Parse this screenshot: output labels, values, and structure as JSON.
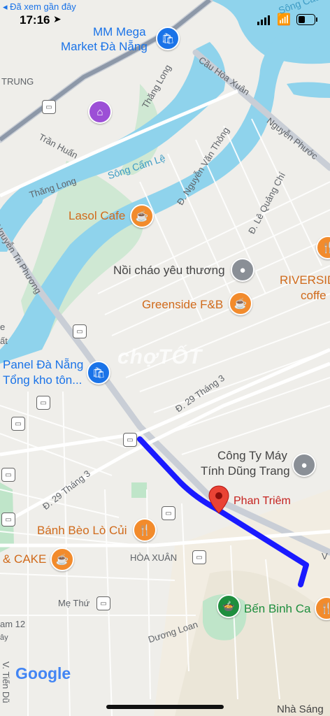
{
  "status_bar": {
    "back_link": "◂ Đã xem gần đây",
    "time": "17:16"
  },
  "pois": [
    {
      "id": "mm-mega-1",
      "text": "MM Mega"
    },
    {
      "id": "mm-mega-2",
      "text": "Market Đà Nẵng"
    },
    {
      "id": "lasol",
      "text": "Lasol Cafe"
    },
    {
      "id": "noi-chao",
      "text": "Nồi cháo yêu thương"
    },
    {
      "id": "greenside",
      "text": "Greenside F&B"
    },
    {
      "id": "riverside-1",
      "text": "RIVERSID"
    },
    {
      "id": "riverside-2",
      "text": "coffe"
    },
    {
      "id": "panel-1",
      "text": "Panel Đà Nẵng"
    },
    {
      "id": "panel-2",
      "text": "Tổng kho tôn..."
    },
    {
      "id": "cong-ty-1",
      "text": "Công Ty Máy"
    },
    {
      "id": "cong-ty-2",
      "text": "Tính Dũng Trang"
    },
    {
      "id": "phan-triem",
      "text": "Phan Triêm"
    },
    {
      "id": "banh-beo",
      "text": "Bánh Bèo Lò Củi"
    },
    {
      "id": "cake",
      "text": "& CAKE"
    },
    {
      "id": "ben-binh-ca",
      "text": "Bến Binh Ca"
    },
    {
      "id": "nha-sang",
      "text": "Nhà Sáng"
    }
  ],
  "streets": [
    {
      "id": "trung",
      "text": "TRUNG"
    },
    {
      "id": "thang-long-1",
      "text": "Thăng Long"
    },
    {
      "id": "tran-huan",
      "text": "Trần Huấn"
    },
    {
      "id": "thang-long-2",
      "text": "Thăng Long"
    },
    {
      "id": "song-cam-le",
      "text": "Sông Cẩm Lệ"
    },
    {
      "id": "cau-hoa-xuan",
      "text": "Cầu Hòa Xuân"
    },
    {
      "id": "nguyen-phuoc",
      "text": "Nguyễn Phước"
    },
    {
      "id": "nguyen-van-thong",
      "text": "Đ. Nguyễn Văn Thông"
    },
    {
      "id": "le-quang-chi",
      "text": "Đ. Lê Quảng Chí"
    },
    {
      "id": "nguyen-tri-phuong",
      "text": "Nguyễn Tri Phương"
    },
    {
      "id": "d29-1",
      "text": "Đ. 29 Tháng 3"
    },
    {
      "id": "d29-2",
      "text": "Đ. 29 Tháng 3"
    },
    {
      "id": "hoa-xuan",
      "text": "HÒA XUÂN"
    },
    {
      "id": "me-thu",
      "text": "Mẹ Thứ"
    },
    {
      "id": "duong-loan",
      "text": "Dương Loan"
    },
    {
      "id": "am12",
      "text": "am 12"
    },
    {
      "id": "ay",
      "text": "ây"
    },
    {
      "id": "v-tien-dung",
      "text": "V. Tiến Dũ"
    },
    {
      "id": "song-cau",
      "text": "Sông Cau"
    },
    {
      "id": "e",
      "text": "e"
    },
    {
      "id": "at",
      "text": "ất"
    },
    {
      "id": "v",
      "text": "V"
    }
  ],
  "watermark": "chợTỐT",
  "google_logo": "Google",
  "colors": {
    "route": "#1a1aff",
    "water": "#8fd3ec",
    "park": "#bfe5c9",
    "road_major": "#c6cbd2",
    "marker_red": "#ea4335",
    "poi_orange": "#f28b2c",
    "poi_blue": "#1a73e8",
    "poi_purple": "#9c4fd6"
  },
  "icons": [
    "location-arrow-icon",
    "cellular-signal-icon",
    "wifi-icon",
    "battery-icon",
    "shopping-bag-icon",
    "cafe-icon",
    "pin-icon",
    "restaurant-icon",
    "bus-stop-icon",
    "landmark-icon",
    "destination-marker-icon"
  ]
}
